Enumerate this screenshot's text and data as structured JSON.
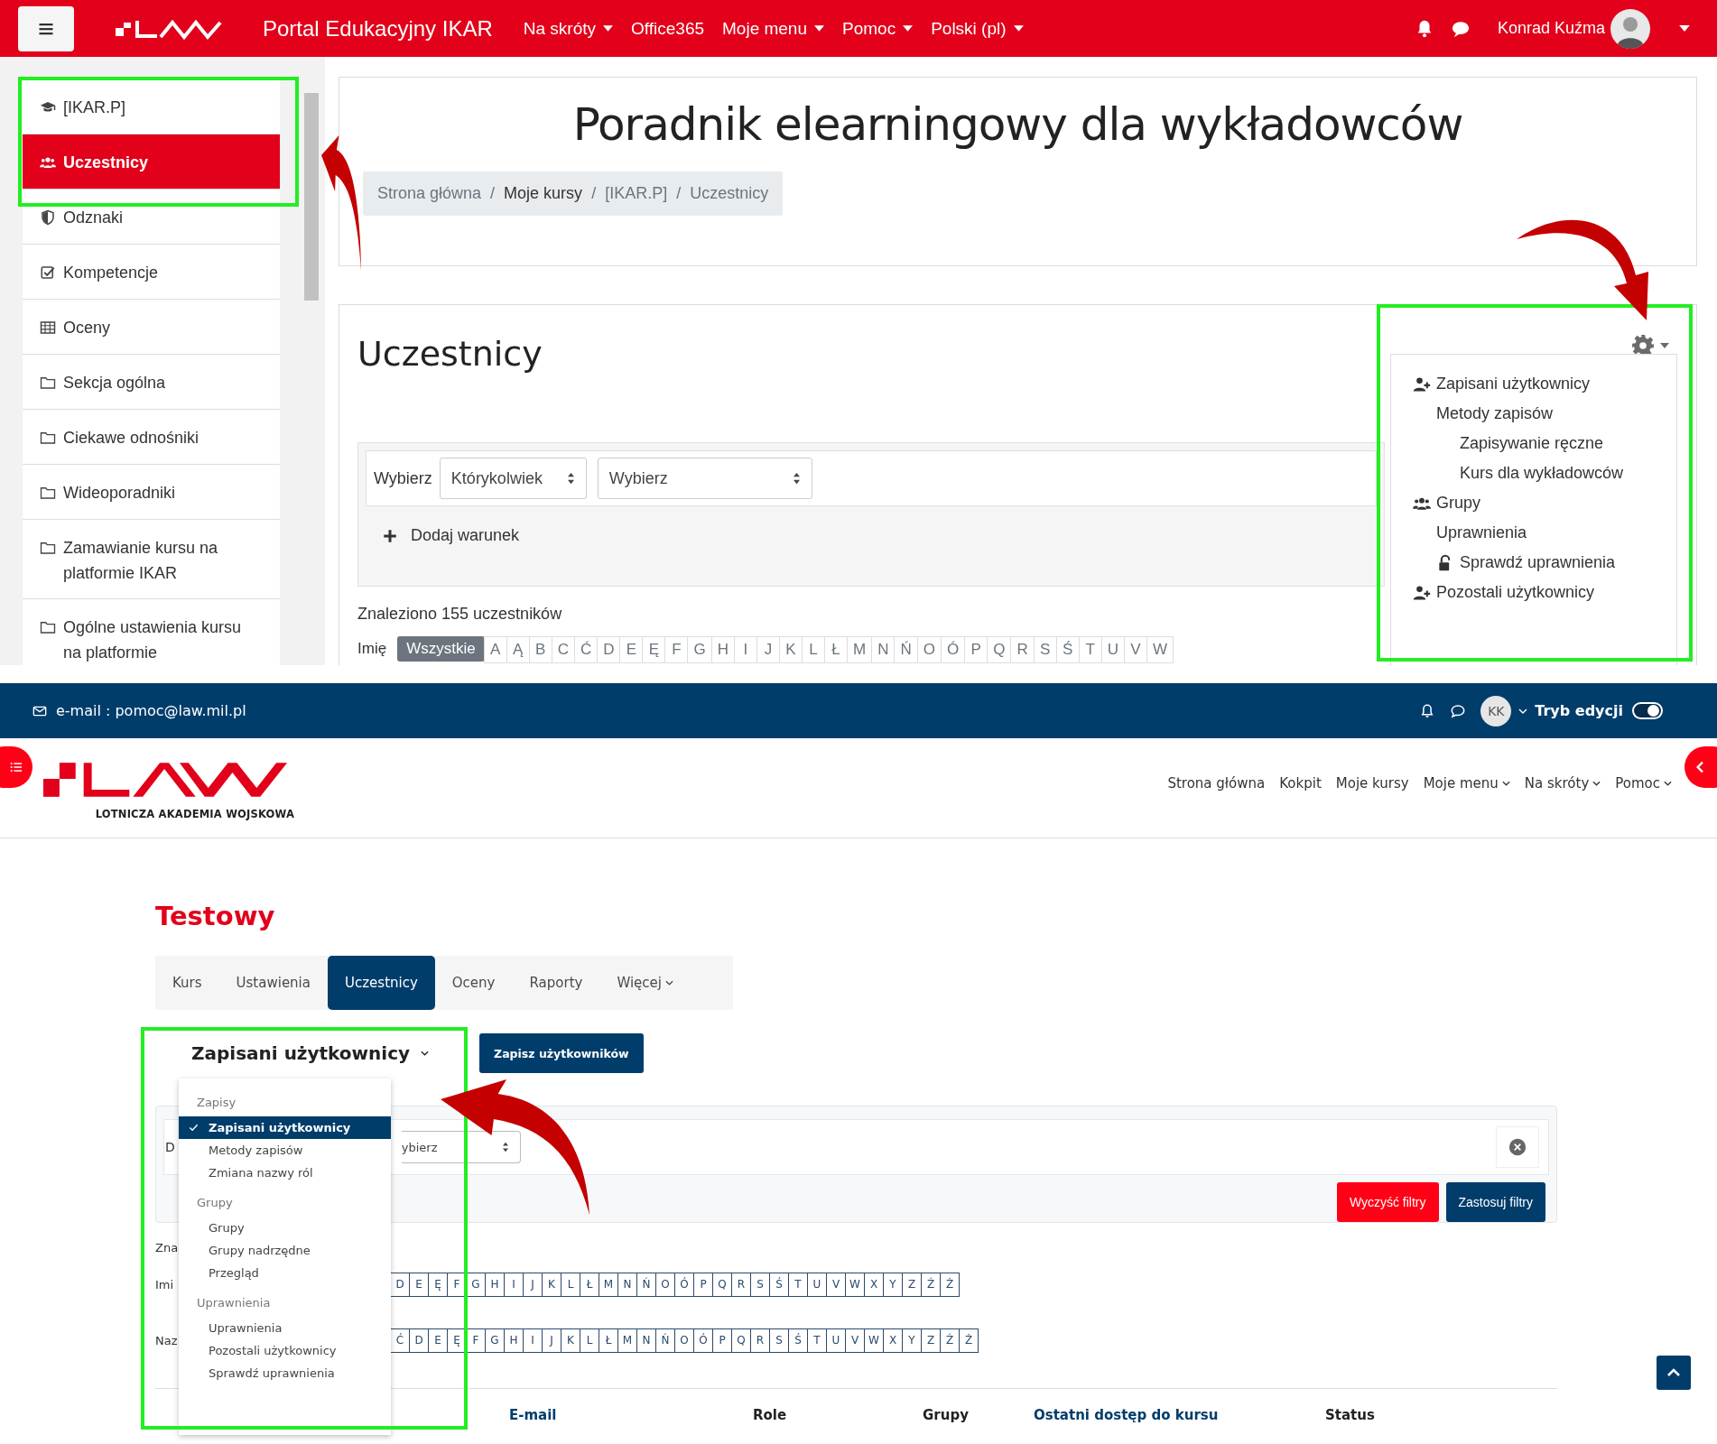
{
  "top_screen": {
    "navbar": {
      "brand": "Portal Edukacyjny IKAR",
      "menu": [
        {
          "label": "Na skróty",
          "dropdown": true
        },
        {
          "label": "Office365",
          "dropdown": false
        },
        {
          "label": "Moje menu",
          "dropdown": true
        },
        {
          "label": "Pomoc",
          "dropdown": true
        },
        {
          "label": "Polski (pl)",
          "dropdown": true
        }
      ],
      "user_name": "Konrad Kuźma"
    },
    "sidebar": {
      "items": [
        {
          "label": "[IKAR.P]",
          "kind": "course",
          "selected": false
        },
        {
          "label": "Uczestnicy",
          "kind": "participants",
          "selected": true
        },
        {
          "label": "Odznaki",
          "kind": "badges",
          "selected": false
        },
        {
          "label": "Kompetencje",
          "kind": "competencies",
          "selected": false
        },
        {
          "label": "Oceny",
          "kind": "grades",
          "selected": false
        },
        {
          "label": "Sekcja ogólna",
          "kind": "section",
          "selected": false
        },
        {
          "label": "Ciekawe odnośniki",
          "kind": "section",
          "selected": false
        },
        {
          "label": "Wideoporadniki",
          "kind": "section",
          "selected": false
        },
        {
          "label": "Zamawianie kursu na platformie IKAR",
          "kind": "section",
          "selected": false
        },
        {
          "label": "Ogólne ustawienia kursu na platformie",
          "kind": "section",
          "selected": false
        }
      ]
    },
    "page_title": "Poradnik elearningowy dla wykładowców",
    "breadcrumb": [
      {
        "label": "Strona główna",
        "link": true
      },
      {
        "separator": "/",
        "label": "Moje kursy",
        "link": false
      },
      {
        "separator": "/",
        "label": "[IKAR.P]",
        "link": true
      },
      {
        "separator": "/",
        "label": "Uczestnicy",
        "link": true
      }
    ],
    "heading": "Uczestnicy",
    "filter": {
      "label": "Wybierz",
      "match": "Którykolwiek",
      "type": "Wybierz",
      "add_condition": "Dodaj warunek"
    },
    "found": "Znaleziono 155 uczestników",
    "first_name_filter": {
      "label": "Imię",
      "all": "Wszystkie",
      "letters": [
        "A",
        "Ą",
        "B",
        "C",
        "Ć",
        "D",
        "E",
        "Ę",
        "F",
        "G",
        "H",
        "I",
        "J",
        "K",
        "L",
        "Ł",
        "M",
        "N",
        "Ń",
        "O",
        "Ó",
        "P",
        "Q",
        "R",
        "S",
        "Ś",
        "T",
        "U",
        "V",
        "W"
      ]
    },
    "settings_menu": {
      "items": [
        {
          "label": "Zapisani użytkownicy",
          "kind": "add-user"
        },
        {
          "label": "Metody zapisów",
          "kind": "plain",
          "children": [
            {
              "label": "Zapisywanie ręczne",
              "kind": "plain"
            },
            {
              "label": "Kurs dla wykładowców",
              "kind": "plain"
            }
          ]
        },
        {
          "label": "Grupy",
          "kind": "group"
        },
        {
          "label": "Uprawnienia",
          "kind": "plain",
          "children": [
            {
              "label": "Sprawdź uprawnienia",
              "kind": "lock"
            }
          ]
        },
        {
          "label": "Pozostali użytkownicy",
          "kind": "add-user"
        }
      ]
    }
  },
  "bottom_screen": {
    "topbar": {
      "email": "e-mail : pomoc@law.mil.pl",
      "avatar": "KK",
      "edit_mode": {
        "label": "Tryb edycji",
        "on": true
      }
    },
    "logo_caption": "LOTNICZA AKADEMIA WOJSKOWA",
    "nav": [
      {
        "label": "Strona główna",
        "dropdown": false
      },
      {
        "label": "Kokpit",
        "dropdown": false
      },
      {
        "label": "Moje kursy",
        "dropdown": false
      },
      {
        "label": "Moje menu",
        "dropdown": true
      },
      {
        "label": "Na skróty",
        "dropdown": true
      },
      {
        "label": "Pomoc",
        "dropdown": true
      }
    ],
    "course_title": "Testowy",
    "tabs": [
      {
        "label": "Kurs",
        "selected": false,
        "dropdown": false
      },
      {
        "label": "Ustawienia",
        "selected": false,
        "dropdown": false
      },
      {
        "label": "Uczestnicy",
        "selected": true,
        "dropdown": false
      },
      {
        "label": "Oceny",
        "selected": false,
        "dropdown": false
      },
      {
        "label": "Raporty",
        "selected": false,
        "dropdown": false
      },
      {
        "label": "Więcej",
        "selected": false,
        "dropdown": true
      }
    ],
    "page_select": "Zapisani użytkownicy",
    "enrol_button": "Zapisz użytkowników",
    "page_menu": {
      "groups": [
        {
          "heading": "Zapisy",
          "items": [
            {
              "label": "Zapisani użytkownicy",
              "selected": true
            },
            {
              "label": "Metody zapisów",
              "selected": false
            },
            {
              "label": "Zmiana nazwy ról",
              "selected": false
            }
          ]
        },
        {
          "heading": "Grupy",
          "items": [
            {
              "label": "Grupy",
              "selected": false
            },
            {
              "label": "Grupy nadrzędne",
              "selected": false
            },
            {
              "label": "Przegląd",
              "selected": false
            }
          ]
        },
        {
          "heading": "Uprawnienia",
          "items": [
            {
              "label": "Uprawnienia",
              "selected": false
            },
            {
              "label": "Pozostali użytkownicy",
              "selected": false
            },
            {
              "label": "Sprawdź uprawnienia",
              "selected": false
            }
          ]
        }
      ]
    },
    "filter": {
      "label_fragment": "D",
      "select_fragment": "ybierz",
      "clear": "Wyczyść filtry",
      "apply": "Zastosuj filtry"
    },
    "found_fragment": "Zna",
    "initial_rows": [
      {
        "label_fragment": "Imi",
        "letters": [
          "D",
          "E",
          "Ę",
          "F",
          "G",
          "H",
          "I",
          "J",
          "K",
          "L",
          "Ł",
          "M",
          "N",
          "Ń",
          "O",
          "Ó",
          "P",
          "Q",
          "R",
          "S",
          "Ś",
          "T",
          "U",
          "V",
          "W",
          "X",
          "Y",
          "Z",
          "Ź",
          "Ż"
        ]
      },
      {
        "label_fragment": "Naz",
        "letters": [
          "Ć",
          "D",
          "E",
          "Ę",
          "F",
          "G",
          "H",
          "I",
          "J",
          "K",
          "L",
          "Ł",
          "M",
          "N",
          "Ń",
          "O",
          "Ó",
          "P",
          "Q",
          "R",
          "S",
          "Ś",
          "T",
          "U",
          "V",
          "W",
          "X",
          "Y",
          "Z",
          "Ź",
          "Ż"
        ]
      }
    ],
    "table": {
      "columns": [
        {
          "label": "E-mail",
          "sortable": true
        },
        {
          "label": "Role",
          "sortable": false
        },
        {
          "label": "Grupy",
          "sortable": false
        },
        {
          "label": "Ostatni dostęp do kursu",
          "sortable": true
        },
        {
          "label": "Status",
          "sortable": false
        }
      ]
    }
  }
}
